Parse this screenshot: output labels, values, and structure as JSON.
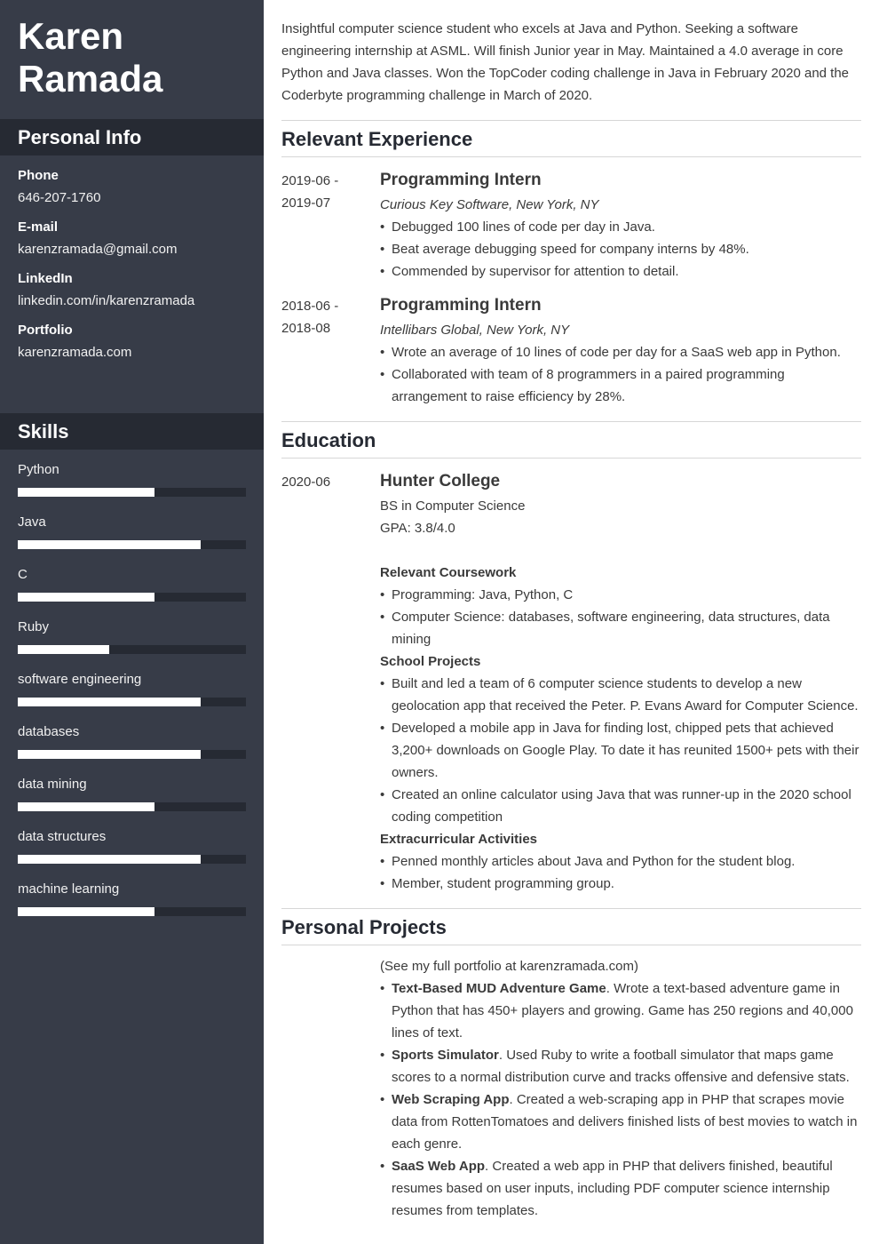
{
  "sidebar": {
    "name_first": "Karen",
    "name_last": "Ramada",
    "personal_info_title": "Personal Info",
    "contacts": [
      {
        "label": "Phone",
        "value": "646-207-1760"
      },
      {
        "label": "E-mail",
        "value": "karenzramada@gmail.com"
      },
      {
        "label": "LinkedIn",
        "value": "linkedin.com/in/karenzramada"
      },
      {
        "label": "Portfolio",
        "value": "karenzramada.com"
      }
    ],
    "skills_title": "Skills",
    "skills": [
      {
        "name": "Python",
        "level": 0.6
      },
      {
        "name": "Java",
        "level": 0.8
      },
      {
        "name": "C",
        "level": 0.6
      },
      {
        "name": "Ruby",
        "level": 0.4
      },
      {
        "name": "software engineering",
        "level": 0.8
      },
      {
        "name": "databases",
        "level": 0.8
      },
      {
        "name": "data mining",
        "level": 0.6
      },
      {
        "name": "data structures",
        "level": 0.8
      },
      {
        "name": "machine learning",
        "level": 0.6
      }
    ]
  },
  "main": {
    "summary": "Insightful computer science student who excels at Java and Python. Seeking a software engineering internship at ASML. Will finish Junior year in May. Maintained a 4.0 average in core Python and Java classes. Won the TopCoder coding challenge in Java in February 2020 and the Coderbyte programming challenge in March of 2020.",
    "experience": {
      "title": "Relevant Experience",
      "entries": [
        {
          "date_start": "2019-06 -",
          "date_end": "2019-07",
          "title": "Programming Intern",
          "company": "Curious Key Software, New York, NY",
          "bullets": [
            "Debugged 100 lines of code per day in Java.",
            "Beat average debugging speed for company interns by 48%.",
            "Commended by supervisor for attention to detail."
          ]
        },
        {
          "date_start": "2018-06 -",
          "date_end": "2018-08",
          "title": "Programming Intern",
          "company": "Intellibars Global, New York, NY",
          "bullets": [
            "Wrote an average of 10 lines of code per day for a SaaS web app in Python.",
            "Collaborated with team of 8 programmers in a paired programming arrangement to raise efficiency by 28%."
          ]
        }
      ]
    },
    "education": {
      "title": "Education",
      "date": "2020-06",
      "school": "Hunter College",
      "degree": "BS in Computer Science",
      "gpa": "GPA: 3.8/4.0",
      "coursework_title": "Relevant Coursework",
      "coursework": [
        "Programming: Java, Python, C",
        "Computer Science: databases, software engineering, data structures, data mining"
      ],
      "projects_title": "School Projects",
      "projects": [
        "Built and led a team of 6 computer science students to develop a new geolocation app that received the Peter. P. Evans Award for Computer Science.",
        "Developed a mobile app in Java for finding lost, chipped pets that achieved 3,200+ downloads on Google Play. To date it has reunited 1500+ pets with their owners.",
        "Created an online calculator using Java that was runner-up in the 2020 school coding competition"
      ],
      "extracurricular_title": "Extracurricular Activities",
      "extracurricular": [
        "Penned monthly articles about Java and Python for the student blog.",
        "Member, student programming group."
      ]
    },
    "personal_projects": {
      "title": "Personal Projects",
      "intro": "(See my full portfolio at karenzramada.com)",
      "items": [
        {
          "name": "Text-Based MUD Adventure Game",
          "desc": ". Wrote a text-based adventure game in Python that has 450+ players and growing. Game has 250 regions and 40,000 lines of text."
        },
        {
          "name": "Sports Simulator",
          "desc": ". Used Ruby to write a football simulator that maps game scores to a normal distribution curve and tracks offensive and defensive stats."
        },
        {
          "name": "Web Scraping App",
          "desc": ". Created a web-scraping app in PHP that scrapes movie data from RottenTomatoes and delivers finished lists of best movies to watch in each genre."
        },
        {
          "name": "SaaS Web App",
          "desc": ". Created a web app in PHP that delivers finished, beautiful resumes based on user inputs, including PDF computer science internship resumes from templates."
        }
      ]
    }
  }
}
